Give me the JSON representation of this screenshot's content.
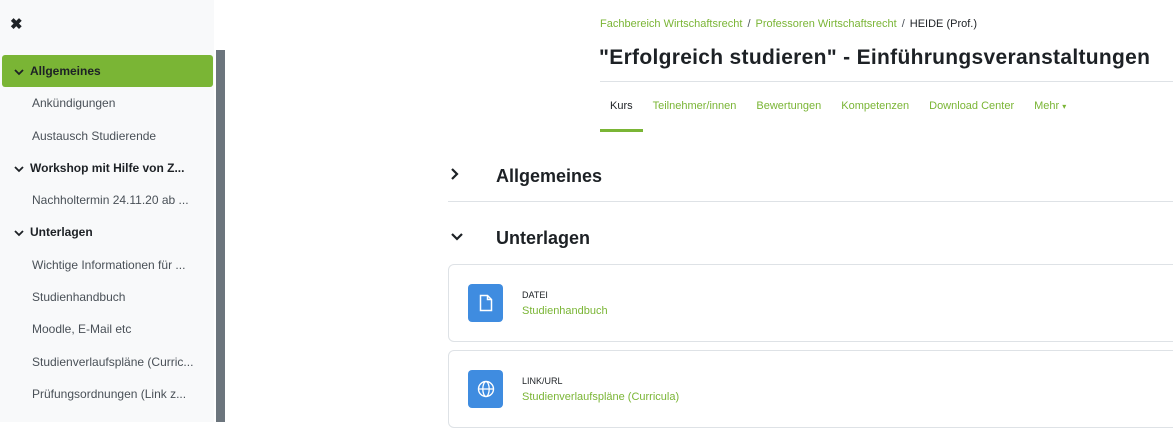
{
  "drawer": {
    "close_icon": "close-icon",
    "items": [
      {
        "label": "Allgemeines",
        "kind": "section",
        "active": true
      },
      {
        "label": "Ankündigungen",
        "kind": "sub"
      },
      {
        "label": "Austausch Studierende",
        "kind": "sub"
      },
      {
        "label": "Workshop mit Hilfe von Z...",
        "kind": "section"
      },
      {
        "label": "Nachholtermin 24.11.20 ab ...",
        "kind": "sub"
      },
      {
        "label": "Unterlagen",
        "kind": "section"
      },
      {
        "label": "Wichtige Informationen für ...",
        "kind": "sub"
      },
      {
        "label": "Studienhandbuch",
        "kind": "sub"
      },
      {
        "label": "Moodle, E-Mail etc",
        "kind": "sub"
      },
      {
        "label": "Studienverlaufspläne (Curric...",
        "kind": "sub"
      },
      {
        "label": "Prüfungsordnungen (Link z...",
        "kind": "sub"
      }
    ]
  },
  "breadcrumb": {
    "items": [
      "Fachbereich Wirtschaftsrecht",
      "Professoren Wirtschaftsrecht"
    ],
    "current": "HEIDE (Prof.)",
    "separator": "/"
  },
  "page": {
    "title": "\"Erfolgreich studieren\" - Einführungsveranstaltungen"
  },
  "tabs": [
    {
      "label": "Kurs",
      "active": true
    },
    {
      "label": "Teilnehmer/innen"
    },
    {
      "label": "Bewertungen"
    },
    {
      "label": "Kompetenzen"
    },
    {
      "label": "Download Center"
    },
    {
      "label": "Mehr",
      "caret": "▾"
    }
  ],
  "sections": [
    {
      "title": "Allgemeines",
      "collapsed": true
    },
    {
      "title": "Unterlagen",
      "collapsed": false
    }
  ],
  "activities": [
    {
      "type": "DATEI",
      "name": "Studienhandbuch",
      "icon": "file-icon"
    },
    {
      "type": "LINK/URL",
      "name": "Studienverlaufspläne (Curricula)",
      "icon": "globe-icon"
    }
  ],
  "colors": {
    "accent": "#7ab535",
    "activity_icon_bg": "#3f8ce0",
    "drawer_bg": "#f8f9fa"
  }
}
